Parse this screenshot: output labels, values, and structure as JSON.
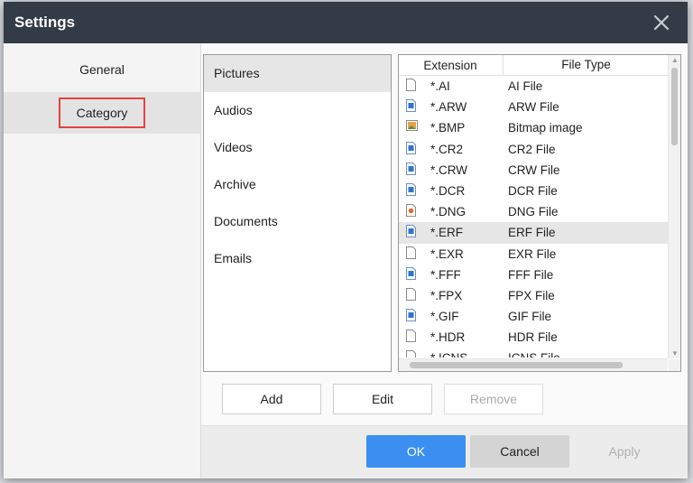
{
  "dialog": {
    "title": "Settings",
    "nav": [
      {
        "label": "General",
        "selected": false
      },
      {
        "label": "Category",
        "selected": true
      }
    ],
    "categories": [
      {
        "label": "Pictures",
        "selected": true
      },
      {
        "label": "Audios",
        "selected": false
      },
      {
        "label": "Videos",
        "selected": false
      },
      {
        "label": "Archive",
        "selected": false
      },
      {
        "label": "Documents",
        "selected": false
      },
      {
        "label": "Emails",
        "selected": false
      }
    ],
    "table": {
      "headers": {
        "extension": "Extension",
        "file_type": "File Type"
      },
      "rows": [
        {
          "ext": "*.AI",
          "type": "AI File",
          "icon": "blank-file-icon"
        },
        {
          "ext": "*.ARW",
          "type": "ARW File",
          "icon": "blue-image-file-icon"
        },
        {
          "ext": "*.BMP",
          "type": "Bitmap image",
          "icon": "bitmap-icon"
        },
        {
          "ext": "*.CR2",
          "type": "CR2 File",
          "icon": "blue-image-file-icon"
        },
        {
          "ext": "*.CRW",
          "type": "CRW File",
          "icon": "blue-image-file-icon"
        },
        {
          "ext": "*.DCR",
          "type": "DCR File",
          "icon": "blue-image-file-icon"
        },
        {
          "ext": "*.DNG",
          "type": "DNG File",
          "icon": "orange-image-file-icon"
        },
        {
          "ext": "*.ERF",
          "type": "ERF File",
          "icon": "blue-image-file-icon",
          "selected": true
        },
        {
          "ext": "*.EXR",
          "type": "EXR File",
          "icon": "blank-file-icon"
        },
        {
          "ext": "*.FFF",
          "type": "FFF File",
          "icon": "blue-image-file-icon"
        },
        {
          "ext": "*.FPX",
          "type": "FPX File",
          "icon": "blank-file-icon"
        },
        {
          "ext": "*.GIF",
          "type": "GIF File",
          "icon": "blue-image-file-icon"
        },
        {
          "ext": "*.HDR",
          "type": "HDR File",
          "icon": "blank-file-icon"
        },
        {
          "ext": "*.ICNS",
          "type": "ICNS File",
          "icon": "blank-file-icon"
        }
      ]
    },
    "actions": {
      "add": "Add",
      "edit": "Edit",
      "remove": "Remove"
    },
    "footer": {
      "ok": "OK",
      "cancel": "Cancel",
      "apply": "Apply"
    }
  },
  "colors": {
    "titlebar": "#333b47",
    "accent": "#3b8ff0",
    "highlight_border": "#e34242",
    "selected_row": "#e6e6e6"
  }
}
